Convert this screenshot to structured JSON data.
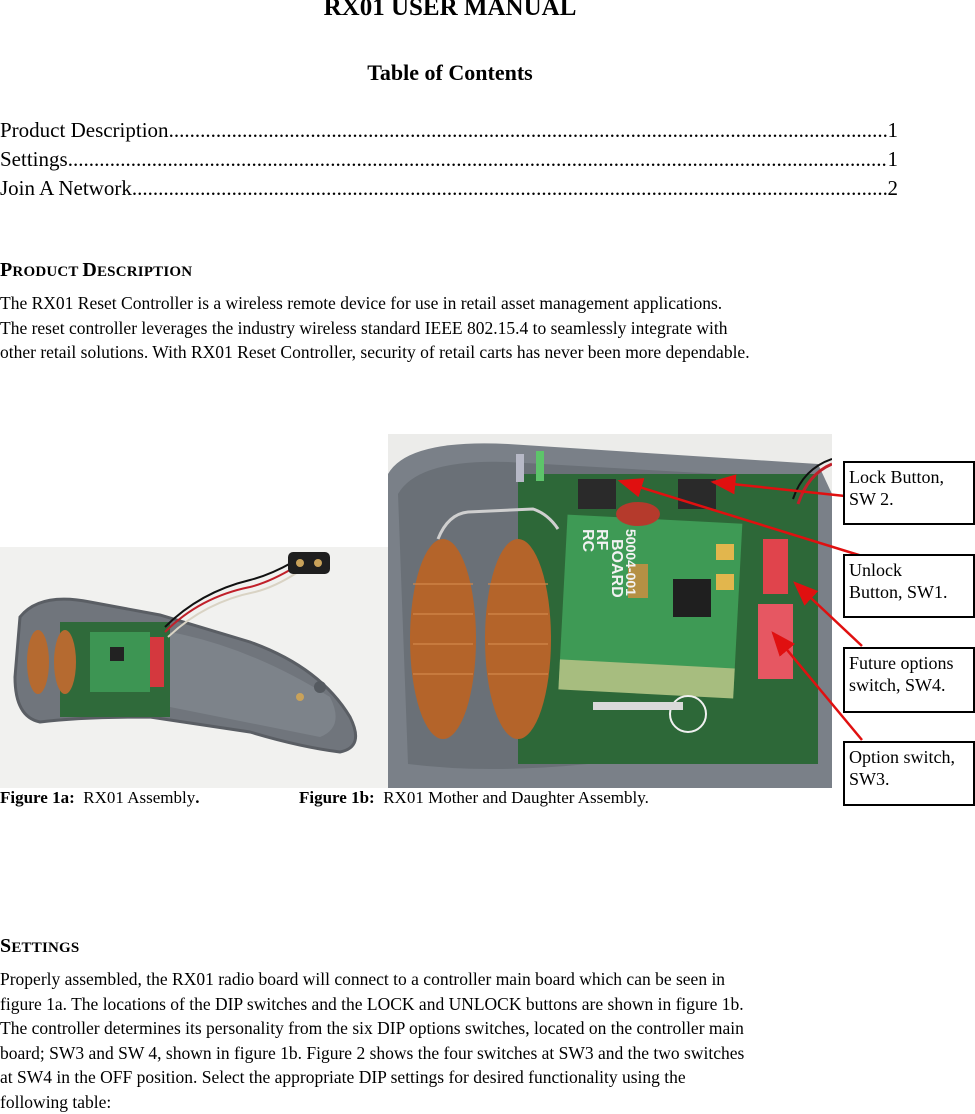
{
  "document": {
    "title": "RX01 USER MANUAL",
    "toc": {
      "title": "Table of Contents",
      "entries": [
        {
          "label": "Product Description ",
          "page": "1"
        },
        {
          "label": "Settings",
          "page": "1"
        },
        {
          "label": "Join A Network",
          "page": "2"
        }
      ]
    },
    "sections": {
      "product_description": {
        "heading_first": "P",
        "heading_rest1": "RODUCT ",
        "heading_second": "D",
        "heading_rest2": "ESCRIPTION",
        "lines": [
          "The RX01 Reset Controller is a wireless remote device for use in retail asset management applications.",
          "The reset controller leverages the industry wireless standard IEEE 802.15.4 to seamlessly integrate with",
          "other retail solutions.  With RX01 Reset Controller, security of retail carts has never been more dependable."
        ]
      },
      "settings": {
        "heading_first": "S",
        "heading_rest": "ETTINGS",
        "lines": [
          "Properly assembled, the RX01 radio board will connect to a controller main board which can be seen in",
          "figure 1a.  The locations of the DIP switches and the LOCK and UNLOCK buttons are shown in figure 1b.",
          "The controller determines its personality from the six DIP options switches, located on the controller main",
          "board; SW3 and SW 4, shown in figure 1b.  Figure 2 shows the four switches at SW3 and the two switches",
          "at SW4 in the OFF position.  Select the appropriate DIP settings for desired functionality using the",
          "following table:"
        ]
      }
    },
    "figures": {
      "fig1a": {
        "label": "Figure 1a:",
        "text": "  RX01 Assembly",
        "period": "."
      },
      "fig1b": {
        "label": "Figure 1b:",
        "text": "  RX01 Mother and Daughter Assembly."
      },
      "callouts": [
        {
          "line1": "Lock Button,",
          "line2": "SW 2."
        },
        {
          "line1": "Unlock",
          "line2": "Button, SW1."
        },
        {
          "line1": "Future options",
          "line2": "switch, SW4."
        },
        {
          "line1": "Option switch,",
          "line2": "SW3."
        }
      ],
      "callout_line_color": "#e01010",
      "board_labels": [
        "RC",
        "RF",
        "BOARD",
        "50004-001"
      ]
    }
  }
}
